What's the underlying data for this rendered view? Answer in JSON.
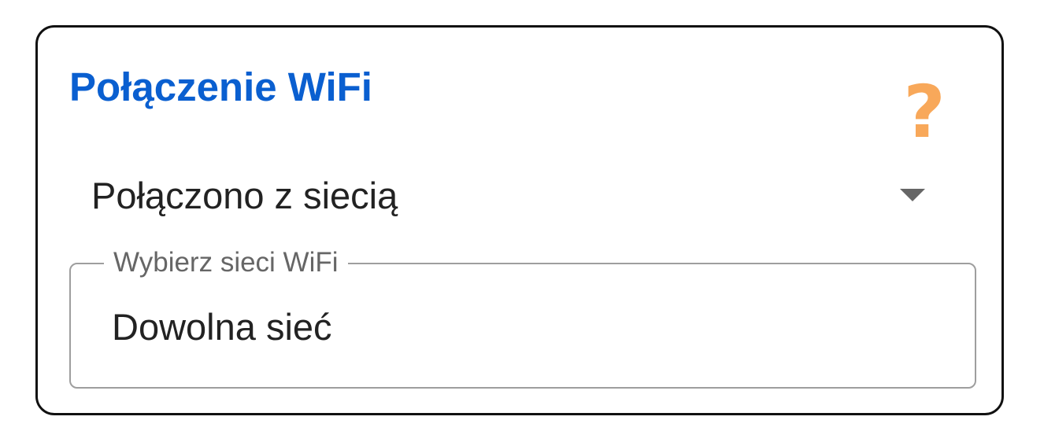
{
  "card": {
    "title": "Połączenie WiFi",
    "help_icon": "help-question-icon",
    "help_glyph": "?",
    "colors": {
      "title": "#0a5fd0",
      "help_icon": "#f8a85a",
      "border": "#111111"
    }
  },
  "connection": {
    "selected_value": "Połączono z siecią",
    "dropdown_icon": "chevron-down-icon"
  },
  "network_select": {
    "label": "Wybierz sieci WiFi",
    "value": "Dowolna sieć"
  }
}
